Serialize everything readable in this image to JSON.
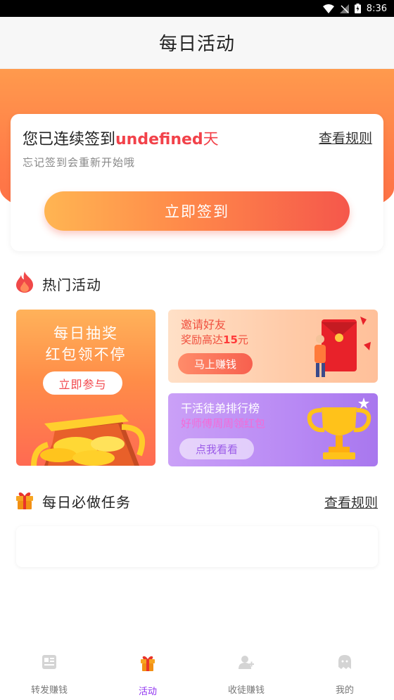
{
  "status_bar": {
    "time": "8:36"
  },
  "header": {
    "title": "每日活动"
  },
  "sign_card": {
    "prefix": "您已连续签到",
    "days": "undefined",
    "unit": "天",
    "rule_link": "查看规则",
    "subtitle": "忘记签到会重新开始哦",
    "button_label": "立即签到"
  },
  "hot_section": {
    "title": "热门活动"
  },
  "activities": {
    "lottery": {
      "line1": "每日抽奖",
      "line2": "红包领不停",
      "button": "立即参与"
    },
    "invite": {
      "title": "邀请好友",
      "desc_prefix": "奖励高达",
      "amount": "15",
      "desc_suffix": "元",
      "button": "马上赚钱"
    },
    "rank": {
      "title": "干活徒弟排行榜",
      "desc": "好师傅周周领红包",
      "button": "点我看看"
    }
  },
  "task_section": {
    "title": "每日必做任务",
    "rule_link": "查看规则"
  },
  "bottom_nav": {
    "items": [
      {
        "label": "转发赚钱",
        "icon": "article-icon"
      },
      {
        "label": "活动",
        "icon": "gift-icon"
      },
      {
        "label": "收徒赚钱",
        "icon": "user-add-icon"
      },
      {
        "label": "我的",
        "icon": "ghost-face-icon"
      }
    ],
    "active_index": 1
  },
  "colors": {
    "accent_orange": "#ff7a48",
    "days_red": "#f2424a",
    "nav_active": "#8e2ff0",
    "rank_purple": "#b889f4"
  }
}
